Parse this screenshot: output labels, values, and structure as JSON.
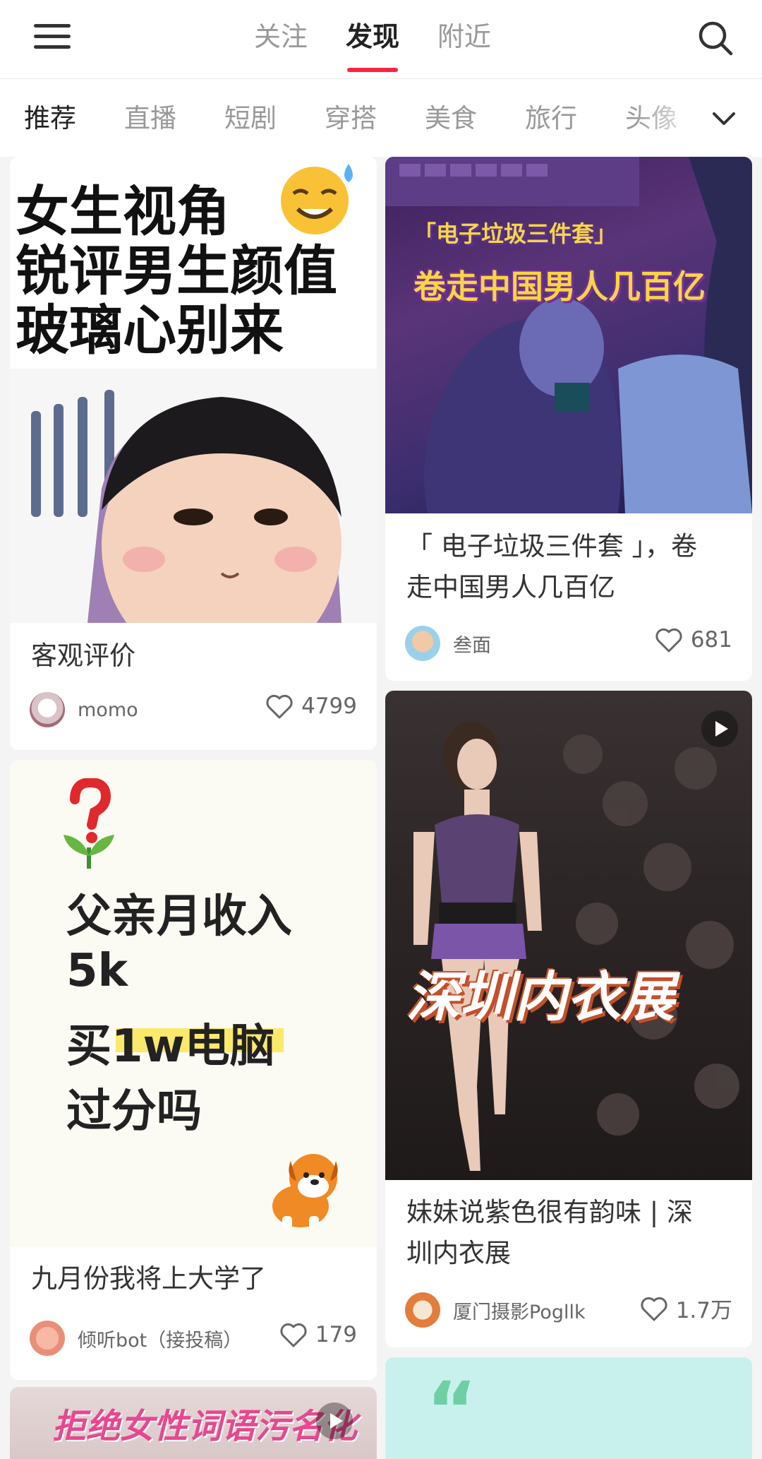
{
  "top_tabs": [
    "关注",
    "发现",
    "附近"
  ],
  "categories": [
    "推荐",
    "直播",
    "短剧",
    "穿搭",
    "美食",
    "旅行",
    "头像"
  ],
  "cards": [
    {
      "cover_text": [
        "女生视角",
        "锐评男生颜值",
        "玻璃心别来"
      ],
      "title": "客观评价",
      "author": "momo",
      "likes": "4799"
    },
    {
      "cover_caption_1": "「电子垃圾三件套」",
      "cover_caption_2": "卷走中国男人几百亿",
      "title_line1": "「 电子垃圾三件套 」，卷",
      "title_line2": "走中国男人几百亿",
      "author": "叁面",
      "likes": "681"
    },
    {
      "cover_text": [
        "父亲月收入",
        "5k",
        "买1w电脑",
        "过分吗"
      ],
      "title": "九月份我将上大学了",
      "author": "倾听bot（接投稿）",
      "likes": "179"
    },
    {
      "cover_caption": "深圳内衣展",
      "title_line1": "妹妹说紫色很有韵味 | 深",
      "title_line2": "圳内衣展",
      "author": "厦门摄影Pogllk",
      "likes": "1.7万"
    },
    {
      "cover_caption": "拒绝女性词语污名化"
    },
    {
      "cover_caption": "“"
    }
  ],
  "colors": {
    "accent": "#ff2442",
    "highlight": "#fbe96b",
    "mint": "#c8f1ee"
  }
}
